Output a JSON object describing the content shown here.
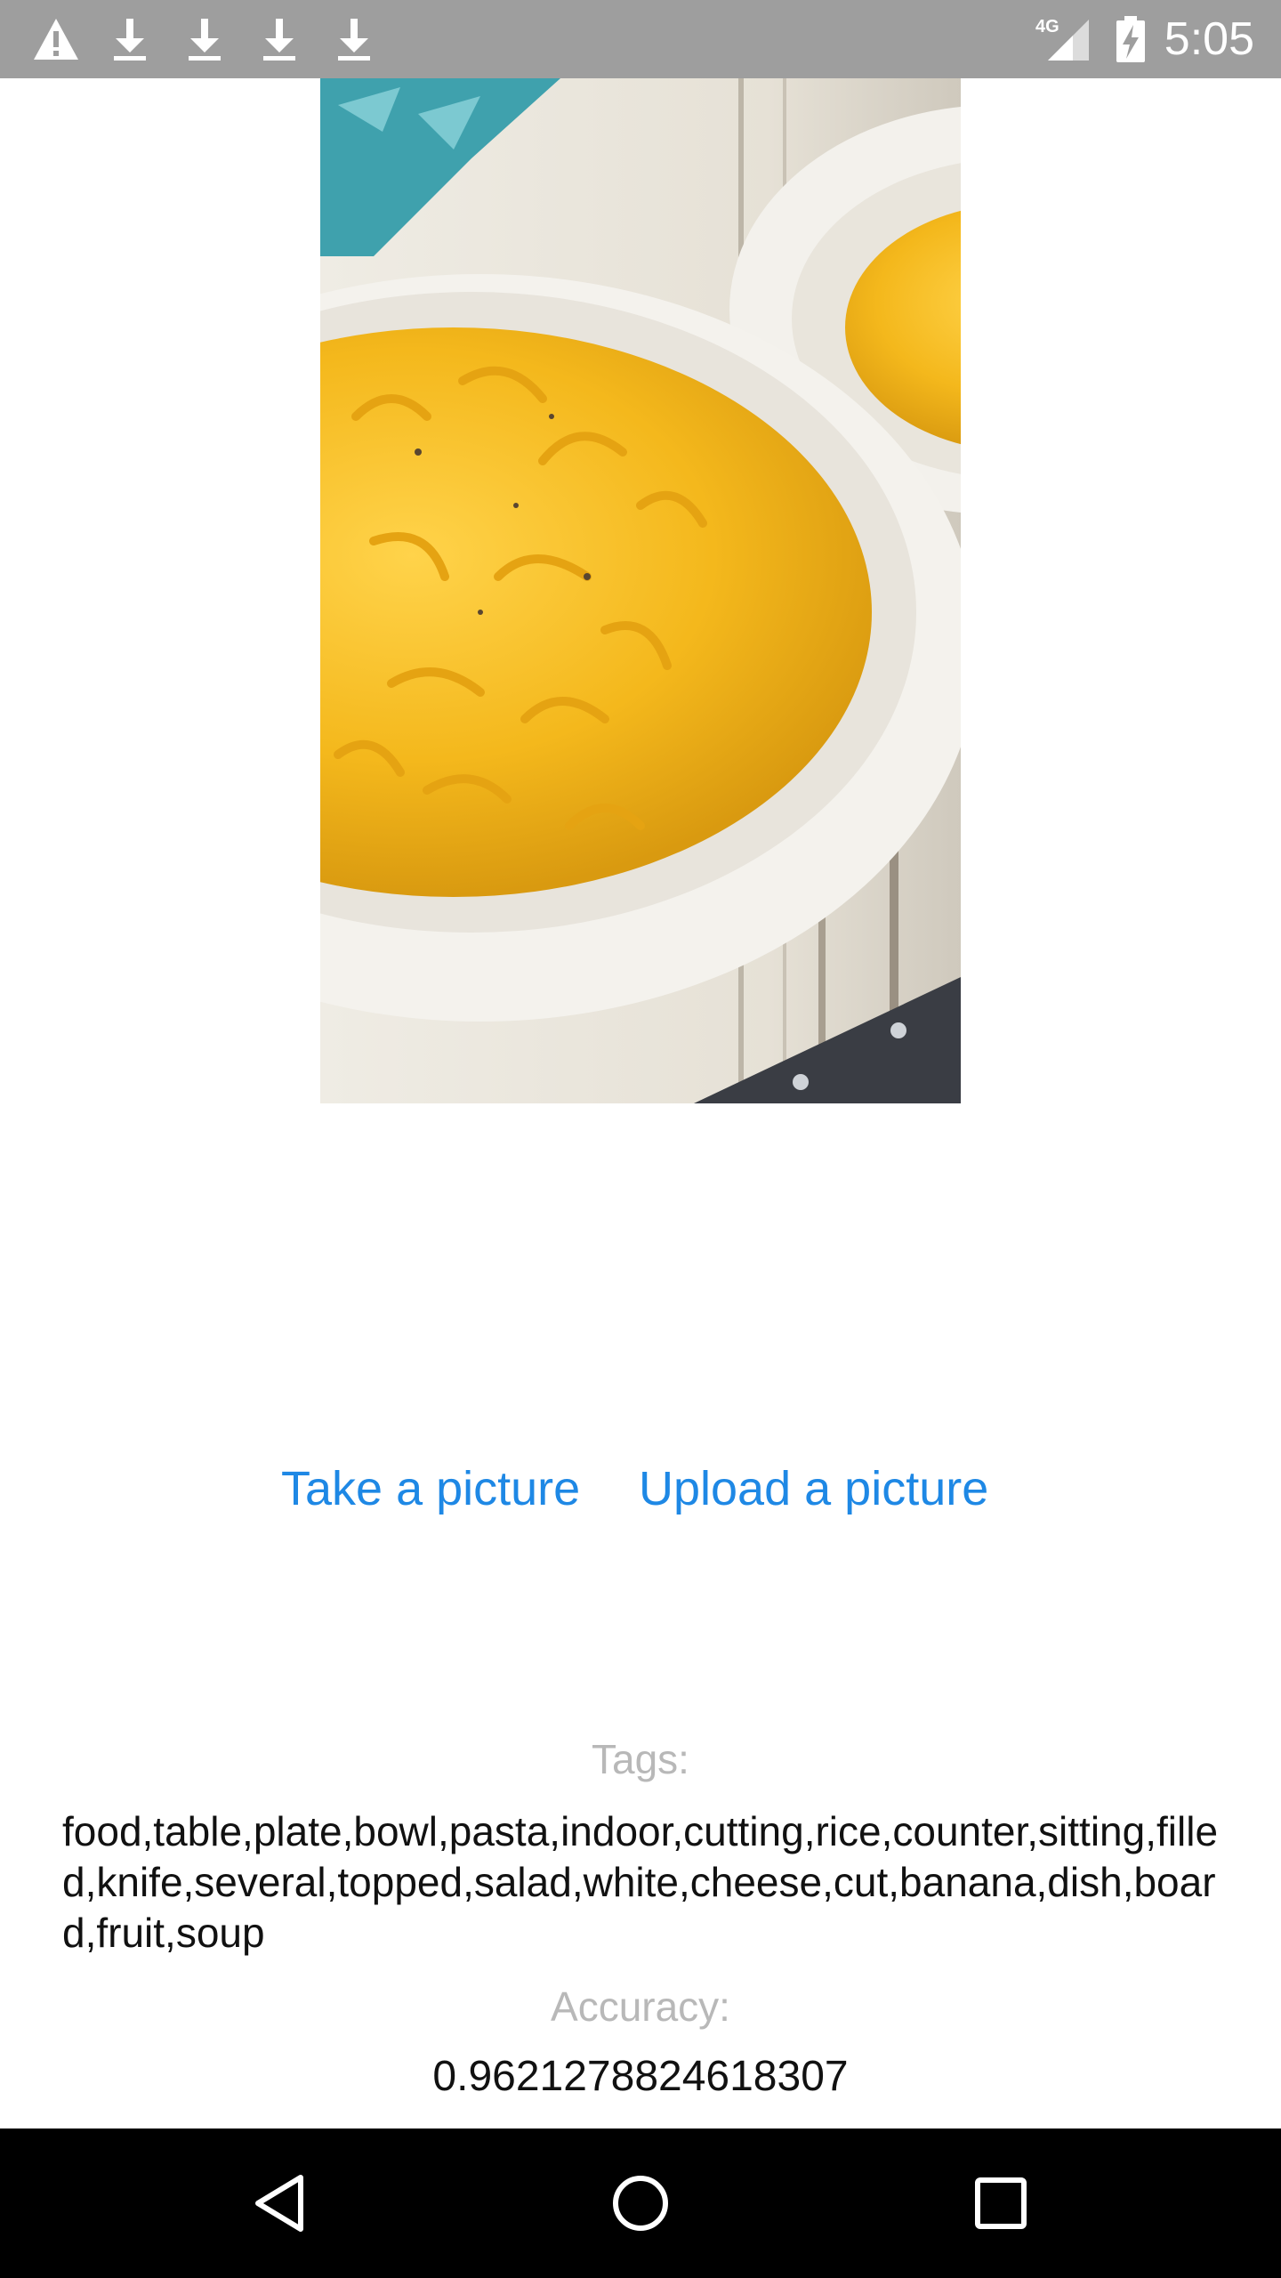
{
  "status_bar": {
    "time": "5:05",
    "network_label": "4G",
    "icons": [
      "warning-icon",
      "download-icon",
      "download-icon",
      "download-icon",
      "download-icon",
      "signal-icon",
      "battery-charging-icon"
    ]
  },
  "main": {
    "photo_alt": "macaroni and cheese in bowl",
    "actions": {
      "take_picture": "Take a picture",
      "upload_picture": "Upload a picture"
    },
    "tags_label": "Tags:",
    "tags_value": "food,table,plate,bowl,pasta,indoor,cutting,rice,counter,sitting,filled,knife,several,topped,salad,white,cheese,cut,banana,dish,board,fruit,soup",
    "accuracy_label": "Accuracy:",
    "accuracy_value": "0.9621278824618307"
  },
  "colors": {
    "status_bar": "#9e9e9e",
    "link": "#1e88e5",
    "muted_label": "#b8b8b8",
    "nav_bar": "#000000"
  },
  "nav_bar": {
    "icons": [
      "back-icon",
      "home-icon",
      "recents-icon"
    ]
  }
}
